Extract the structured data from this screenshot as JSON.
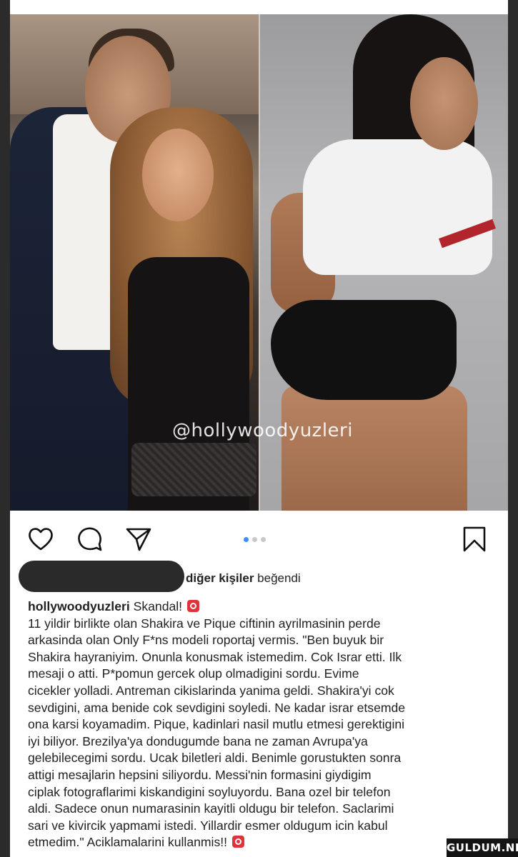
{
  "post": {
    "watermark": "@hollywoodyuzleri",
    "carousel": {
      "count": 3,
      "active_index": 0
    },
    "likes": {
      "text_bold": "diğer kişiler",
      "text_rest": " beğendi"
    },
    "caption": {
      "username": "hollywoodyuzleri",
      "headline": " Skandal!",
      "lines": [
        "11 yildir birlikte olan Shakira ve Pique ciftinin ayrilmasinin perde",
        "arkasinda olan Only F*ns modeli roportaj vermis. \"Ben buyuk bir",
        "Shakira hayraniyim. Onunla konusmak istemedim. Cok Israr etti. Ilk",
        "mesaji o atti. P*pomun gercek olup olmadigini sordu. Evime",
        "cicekler yolladi. Antreman cikislarinda yanima geldi. Shakira'yi cok",
        "sevdigini, ama benide cok sevdigini soyledi. Ne kadar israr etsemde",
        "ona karsi koyamadim. Pique, kadinlari nasil mutlu etmesi gerektigini",
        "iyi biliyor. Brezilya'ya dondugumde bana ne zaman Avrupa'ya",
        "gelebilecegimi sordu. Ucak biletleri aldi. Benimle gorustukten sonra",
        "attigi mesajlarin hepsini siliyordu. Messi'nin formasini giydigim",
        "ciplak fotograflarimi kiskandigini soyluyordu. Bana ozel bir telefon",
        "aldi. Sadece onun numarasinin kayitli oldugu bir telefon. Saclarimi",
        "sari ve kivircik yapmami istedi. Yillardir esmer oldugum icin kabul"
      ],
      "last_line": "etmedim.\" Aciklamalarini kullanmis!!"
    }
  },
  "icons": {
    "like": "heart-icon",
    "comment": "comment-icon",
    "share": "send-icon",
    "save": "bookmark-icon",
    "badge": "alarm-emoji-icon"
  },
  "site_logo": "GULDUM.NET",
  "colors": {
    "accent_dot": "#3d8ff5",
    "badge": "#e0323a"
  }
}
